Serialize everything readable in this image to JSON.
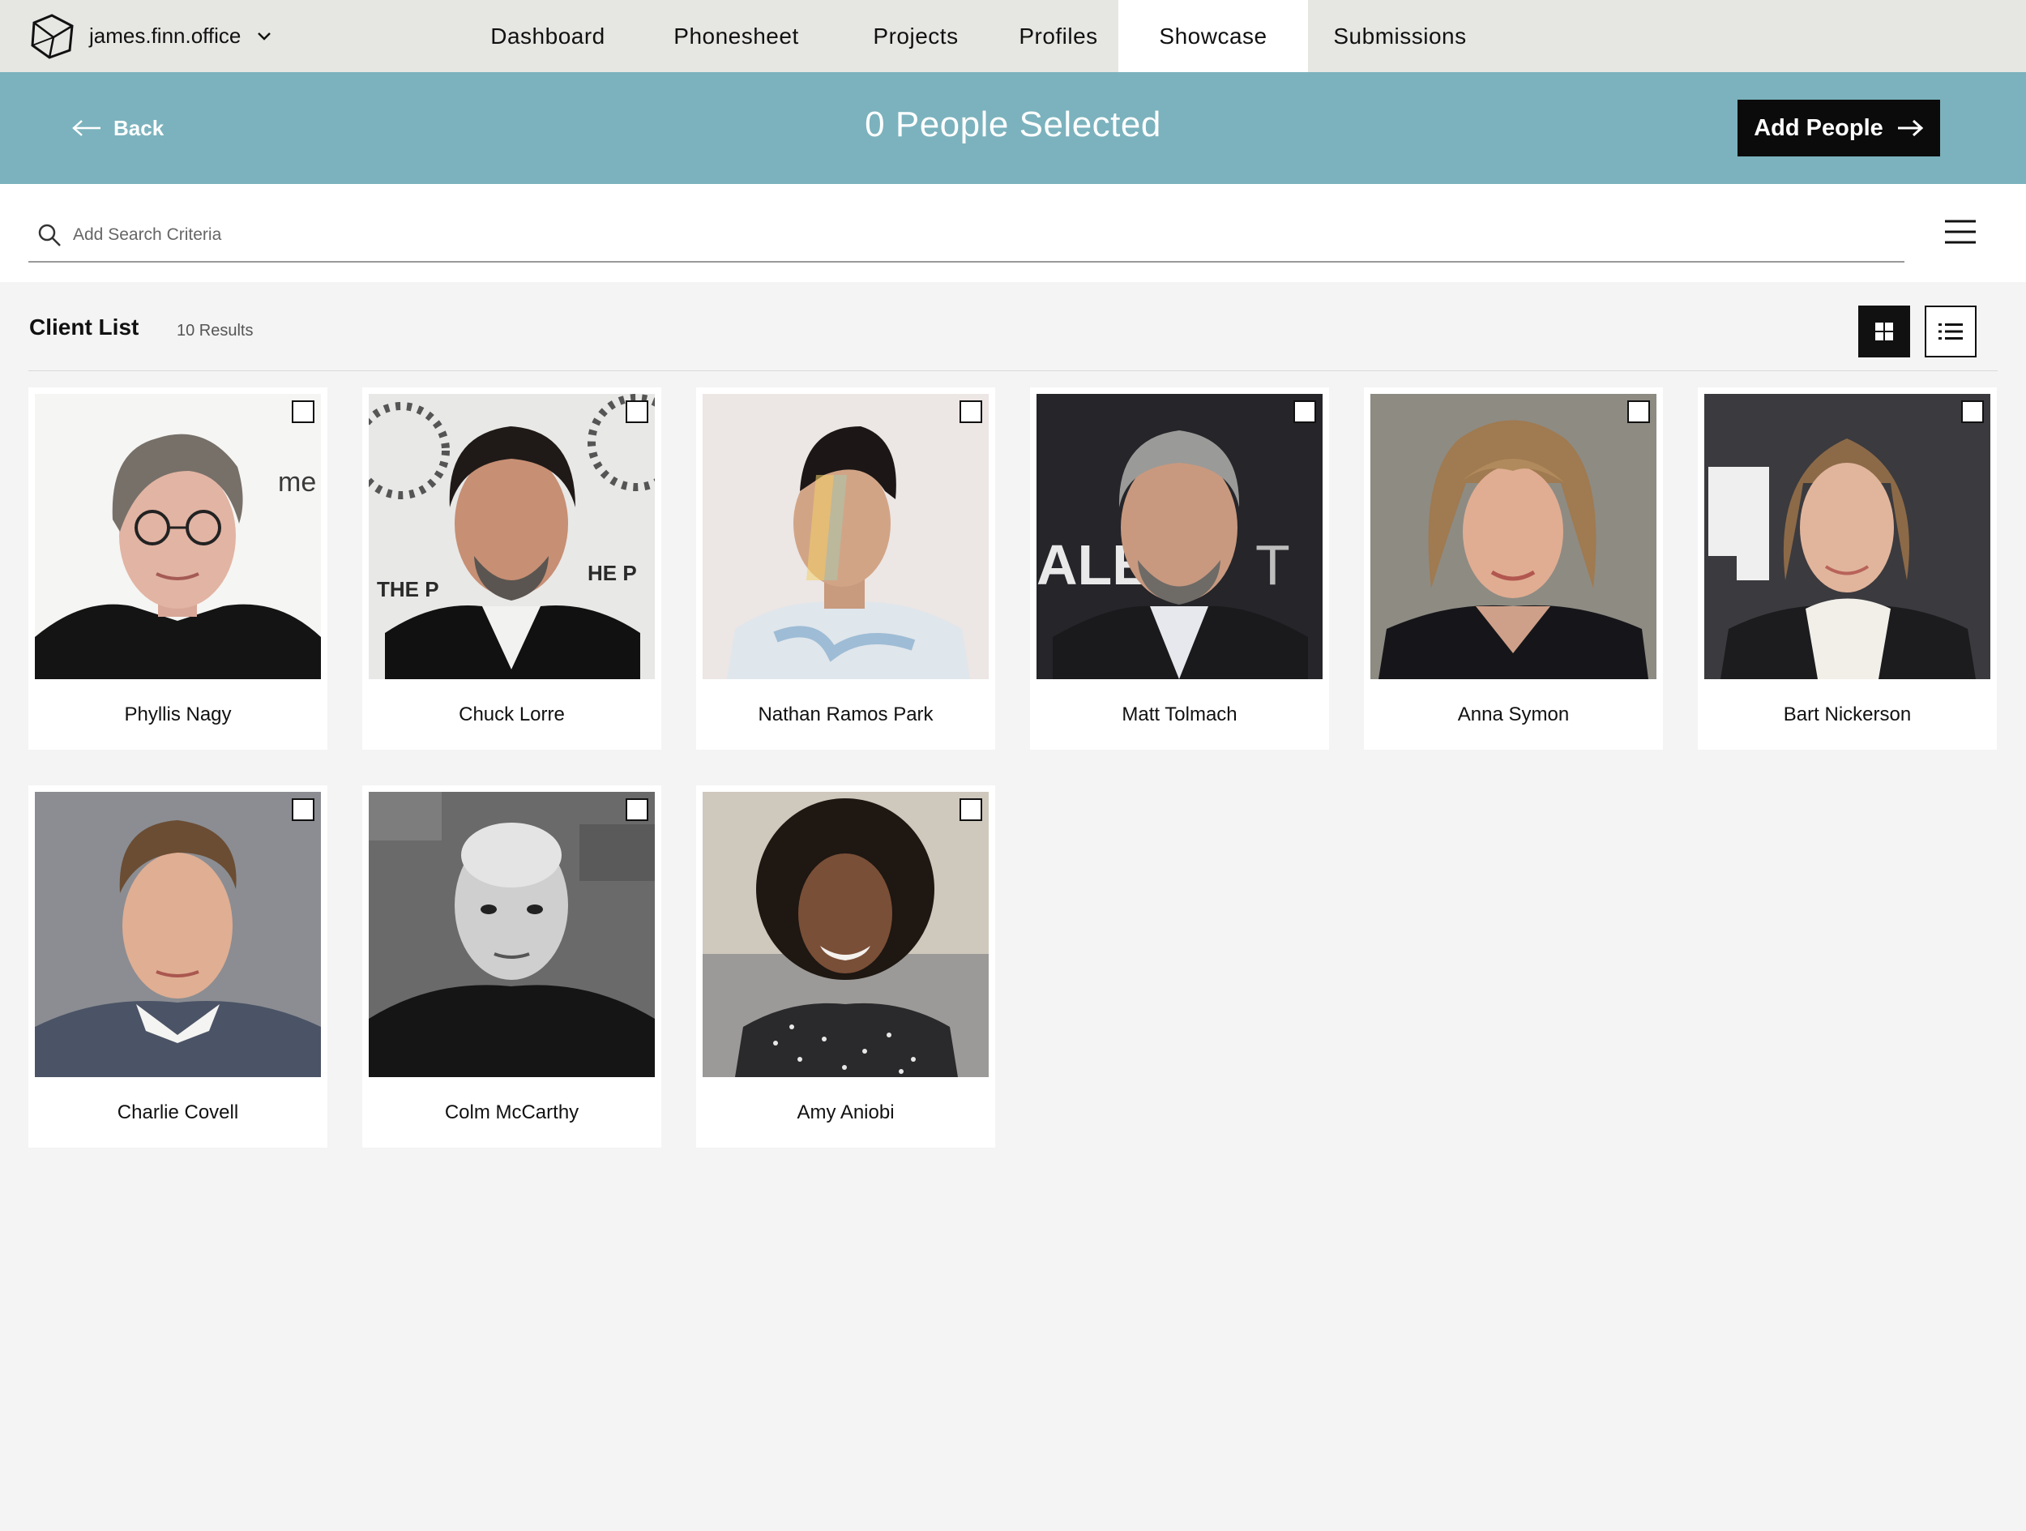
{
  "topnav": {
    "account": "james.finn.office",
    "tabs": [
      {
        "label": "Dashboard"
      },
      {
        "label": "Phonesheet"
      },
      {
        "label": "Projects"
      },
      {
        "label": "Profiles"
      },
      {
        "label": "Showcase",
        "active": true
      },
      {
        "label": "Submissions"
      }
    ]
  },
  "banner": {
    "back_label": "Back",
    "title": "0 People Selected",
    "add_label": "Add People",
    "color": "#7bb2bd"
  },
  "search": {
    "placeholder": "Add Search Criteria",
    "value": ""
  },
  "list": {
    "title": "Client List",
    "count": "10 Results",
    "view_mode": "grid"
  },
  "people": [
    {
      "name": "Phyllis Nagy",
      "selected": false
    },
    {
      "name": "Chuck Lorre",
      "selected": false
    },
    {
      "name": "Nathan Ramos Park",
      "selected": false
    },
    {
      "name": "Matt Tolmach",
      "selected": false
    },
    {
      "name": "Anna Symon",
      "selected": false
    },
    {
      "name": "Bart Nickerson",
      "selected": false
    },
    {
      "name": "Charlie Covell",
      "selected": false
    },
    {
      "name": "Colm McCarthy",
      "selected": false
    },
    {
      "name": "Amy Aniobi",
      "selected": false
    }
  ]
}
